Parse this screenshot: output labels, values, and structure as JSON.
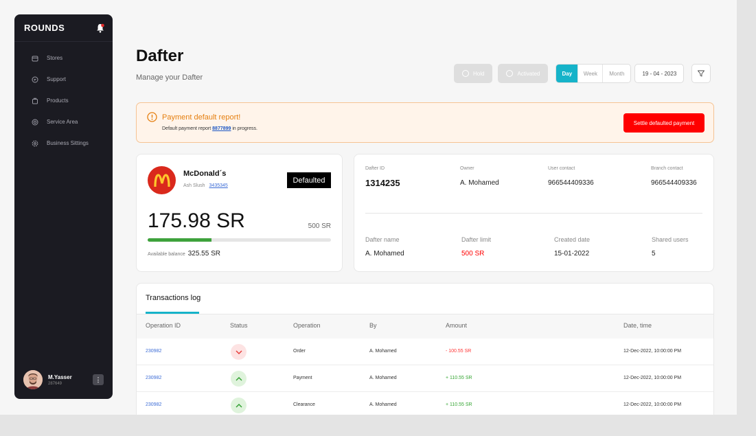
{
  "sidebar": {
    "logo": "ROUNDS",
    "items": [
      {
        "label": "Stores",
        "icon": "store-icon"
      },
      {
        "label": "Support",
        "icon": "support-icon"
      },
      {
        "label": "Products",
        "icon": "products-icon"
      },
      {
        "label": "Service Area",
        "icon": "service-area-icon"
      },
      {
        "label": "Business Sittings",
        "icon": "settings-icon"
      }
    ],
    "user": {
      "name": "M.Yasser",
      "id": "287649"
    }
  },
  "header": {
    "title": "Dafter",
    "subtitle": "Manage your Dafter",
    "hold_label": "Hold",
    "activated_label": "Activated",
    "periods": [
      "Day",
      "Week",
      "Month"
    ],
    "active_period": "Day",
    "date": "19 - 04 - 2023"
  },
  "alert": {
    "title": "Payment default report!",
    "desc_prefix": "Default payment report",
    "report_id": "8877899",
    "desc_suffix": "in progress.",
    "action": "Settle defaulted payment"
  },
  "store": {
    "name": "McDonald´s",
    "owner": "Ash Slush",
    "store_id": "3435345",
    "status": "Defaulted",
    "balance": "175.98 SR",
    "limit": "500 SR",
    "progress_fraction": 0.35,
    "available_label": "Available balance",
    "available_value": "325.55 SR"
  },
  "details": {
    "row1": [
      {
        "label": "Dafter ID",
        "value": "1314235"
      },
      {
        "label": "Owner",
        "value": "A. Mohamed"
      },
      {
        "label": "User contact",
        "value": "966544409336"
      },
      {
        "label": "Branch contact",
        "value": "966544409336"
      }
    ],
    "row2": [
      {
        "label": "Dafter name",
        "value": "A. Mohamed"
      },
      {
        "label": "Dafter limit",
        "value": "500 SR"
      },
      {
        "label": "Created date",
        "value": "15-01-2022"
      },
      {
        "label": "Shared users",
        "value": "5"
      }
    ]
  },
  "transactions": {
    "tab": "Transactions log",
    "columns": [
      "Operation ID",
      "Status",
      "Operation",
      "By",
      "Amount",
      "Date, time"
    ],
    "rows": [
      {
        "id": "230982",
        "status": "down",
        "operation": "Order",
        "by": "A. Mohamed",
        "amount": "- 100.55 SR",
        "date": "12-Dec-2022, 10:00:00 PM"
      },
      {
        "id": "230982",
        "status": "up",
        "operation": "Payment",
        "by": "A. Mohamed",
        "amount": "+ 110.55 SR",
        "date": "12-Dec-2022, 10:00:00 PM"
      },
      {
        "id": "230982",
        "status": "up",
        "operation": "Clearance",
        "by": "A. Mohamed",
        "amount": "+ 110.55 SR",
        "date": "12-Dec-2022, 10:00:00 PM"
      }
    ]
  },
  "colors": {
    "accent": "#16b3c9",
    "danger": "#ff0000",
    "success": "#3ea23c",
    "sidebar": "#1b1b22"
  }
}
